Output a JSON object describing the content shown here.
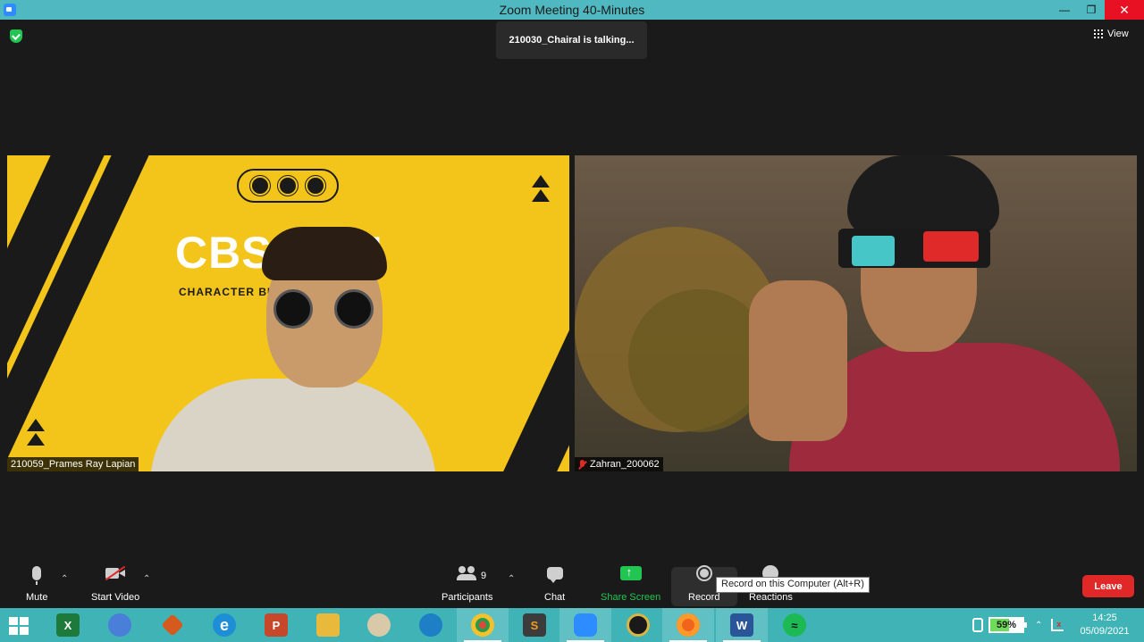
{
  "window": {
    "title": "Zoom Meeting 40-Minutes"
  },
  "overlay": {
    "talking": "210030_Chairal is talking...",
    "view_label": "View"
  },
  "tiles": [
    {
      "name": "210059_Prames Ray Lapian",
      "banner_title": "CBS 2021",
      "banner_subtitle": "CHARACTER BUILDING SESSION",
      "muted": false
    },
    {
      "name": "Zahran_200062",
      "muted": true
    }
  ],
  "toolbar": {
    "mute_label": "Mute",
    "video_label": "Start Video",
    "participants_label": "Participants",
    "participants_count": "9",
    "chat_label": "Chat",
    "share_label": "Share Screen",
    "record_label": "Record",
    "reactions_label": "Reactions",
    "record_tooltip": "Record on this Computer (Alt+R)",
    "leave_label": "Leave"
  },
  "taskbar": {
    "apps": [
      "excel",
      "chrome-canary",
      "matlab",
      "internet-explorer",
      "powerpoint",
      "file-explorer",
      "paint",
      "edge",
      "chrome",
      "sublime-text",
      "zoom",
      "app-circle",
      "firefox",
      "word",
      "spotify"
    ],
    "active_apps": [
      "chrome",
      "zoom",
      "firefox",
      "word"
    ],
    "battery_percent": "59%",
    "time": "14:25",
    "date": "05/09/2021"
  },
  "colors": {
    "titlebar": "#4fb8c0",
    "taskbar": "#3fb3b6",
    "leave": "#e02828",
    "share": "#23c552"
  }
}
